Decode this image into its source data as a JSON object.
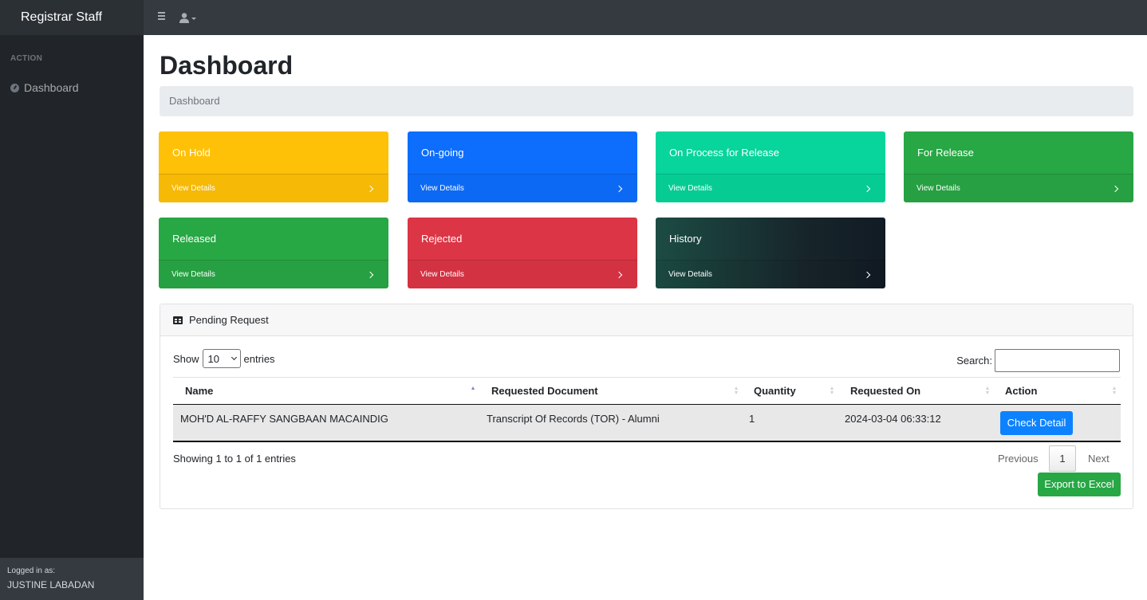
{
  "app": {
    "title": "Registrar Staff"
  },
  "topbar": {
    "menu_icon": "hamburger-icon",
    "user_icon": "user-icon"
  },
  "sidebar": {
    "heading": "ACTION",
    "items": [
      {
        "label": "Dashboard",
        "icon": "dashboard-icon"
      }
    ],
    "footer": {
      "label": "Logged in as:",
      "user": "JUSTINE LABADAN"
    }
  },
  "page": {
    "title": "Dashboard",
    "breadcrumb": "Dashboard"
  },
  "cards": [
    {
      "title": "On Hold",
      "link": "View Details",
      "color": "#ffc107"
    },
    {
      "title": "On-going",
      "link": "View Details",
      "color": "#0d6efd"
    },
    {
      "title": "On Process for Release",
      "link": "View Details",
      "color": "#07d59b"
    },
    {
      "title": "For Release",
      "link": "View Details",
      "color": "#28a745"
    },
    {
      "title": "Released",
      "link": "View Details",
      "color": "#28a745"
    },
    {
      "title": "Rejected",
      "link": "View Details",
      "color": "#dc3545"
    },
    {
      "title": "History",
      "link": "View Details",
      "color": "#17252a"
    }
  ],
  "table_panel": {
    "title": "Pending Request",
    "icon": "table-icon",
    "length": {
      "label_before": "Show",
      "value": "10",
      "label_after": "entries"
    },
    "search": {
      "label": "Search:",
      "value": ""
    },
    "columns": [
      "Name",
      "Requested Document",
      "Quantity",
      "Requested On",
      "Action"
    ],
    "rows": [
      {
        "name": "MOH'D AL-RAFFY SANGBAAN MACAINDIG",
        "document": "Transcript Of Records (TOR) - Alumni",
        "quantity": "1",
        "requested_on": "2024-03-04 06:33:12",
        "action": "Check Detail"
      }
    ],
    "info": "Showing 1 to 1 of 1 entries",
    "pagination": {
      "previous": "Previous",
      "current": "1",
      "next": "Next"
    },
    "export_label": "Export to Excel"
  }
}
